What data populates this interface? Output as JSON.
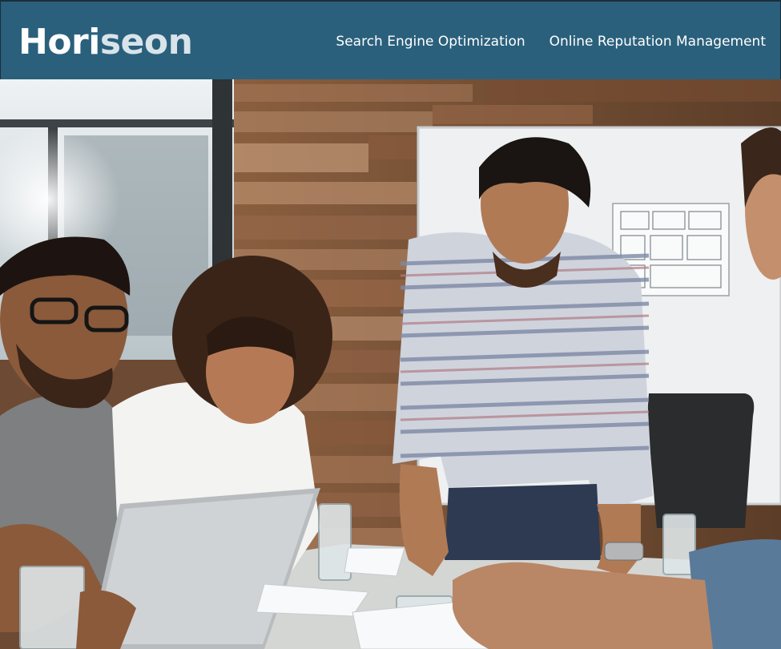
{
  "header": {
    "logo": {
      "part1": "Hori",
      "part2": "seon"
    },
    "nav": [
      {
        "label": "Search Engine Optimization"
      },
      {
        "label": "Online Reputation Management"
      }
    ]
  },
  "hero": {
    "image": "photo-of-business-team-meeting-around-table-with-laptop-and-papers"
  },
  "colors": {
    "header_bg": "#2a607c",
    "header_text": "#ffffff"
  }
}
